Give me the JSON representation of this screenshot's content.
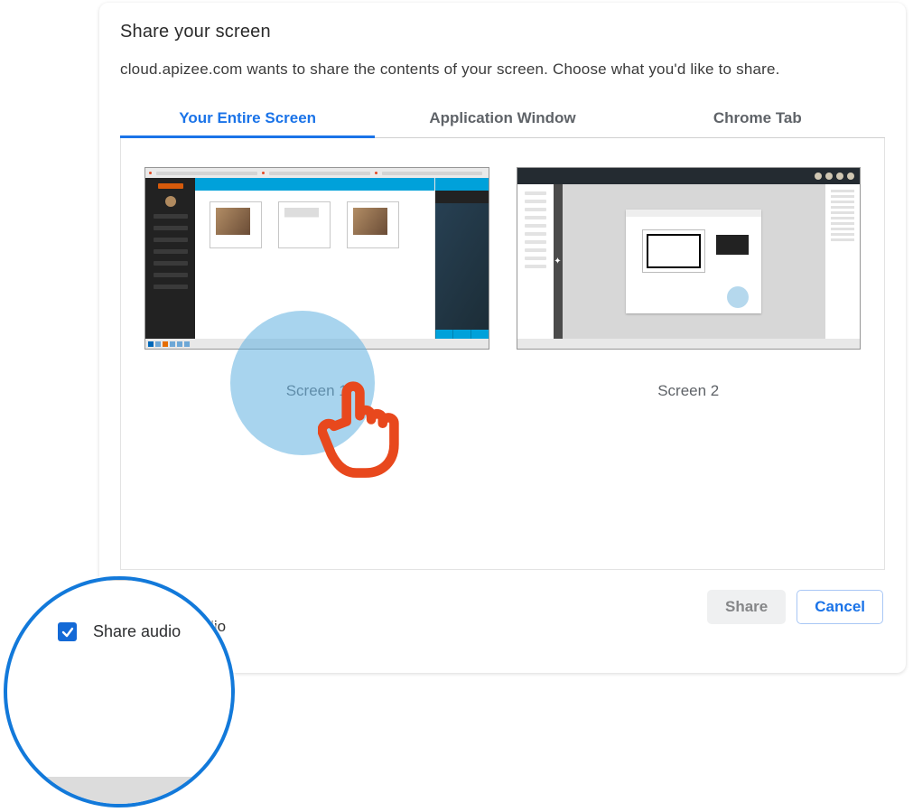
{
  "dialog": {
    "title": "Share your screen",
    "description": "cloud.apizee.com wants to share the contents of your screen. Choose what you'd like to share."
  },
  "tabs": {
    "entire": "Your Entire Screen",
    "window": "Application Window",
    "tab": "Chrome Tab"
  },
  "screens": {
    "s1": "Screen 1",
    "s2": "Screen 2"
  },
  "audio": {
    "label": "Share audio",
    "sliver": "udio",
    "checked": true
  },
  "buttons": {
    "share": "Share",
    "cancel": "Cancel"
  },
  "colors": {
    "accent": "#1a73e8",
    "ring": "#1279da",
    "pointer": "#e8481d"
  }
}
